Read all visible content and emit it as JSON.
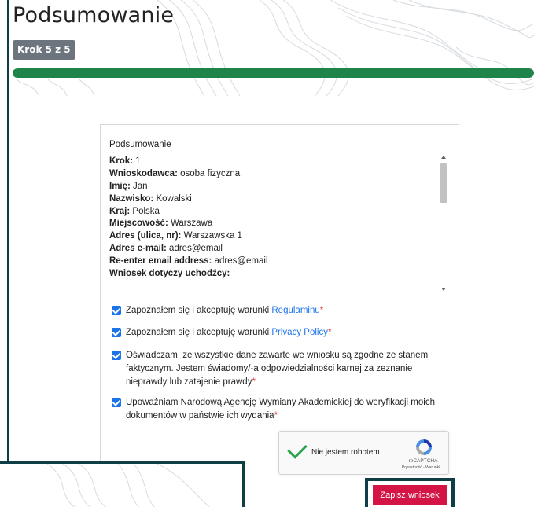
{
  "header": {
    "title": "Podsumowanie",
    "step_badge": "Krok 5 z 5",
    "progress_fraction": 1.0,
    "accent_color": "#1e8449"
  },
  "summary": {
    "heading": "Podsumowanie",
    "rows": [
      {
        "label": "Krok:",
        "value": " 1"
      },
      {
        "label": "Wnioskodawca:",
        "value": " osoba fizyczna"
      },
      {
        "label": "Imię:",
        "value": " Jan"
      },
      {
        "label": "Nazwisko:",
        "value": " Kowalski"
      },
      {
        "label": "Kraj:",
        "value": " Polska"
      },
      {
        "label": "Miejscowość:",
        "value": " Warszawa"
      },
      {
        "label": "Adres (ulica, nr):",
        "value": " Warszawska 1"
      },
      {
        "label": "Adres e-mail:",
        "value": " adres@email"
      },
      {
        "label": "Re-enter email address:",
        "value": " adres@email"
      },
      {
        "label": "Wniosek dotyczy uchodźcy:",
        "value": ""
      }
    ]
  },
  "consents": [
    {
      "text": "Zapoznałem się i akceptuję warunki ",
      "link": "Regulaminu",
      "required": "*"
    },
    {
      "text": "Zapoznałem się i akceptuję warunki ",
      "link": "Privacy Policy",
      "required": "*"
    },
    {
      "text": "Oświadczam, że wszystkie dane zawarte we wniosku są zgodne ze stanem faktycznym. Jestem świadomy/-a odpowiedzialności karnej za zeznanie nieprawdy lub zatajenie prawdy",
      "link": "",
      "required": "*"
    },
    {
      "text": "Upoważniam Narodową Agencję Wymiany Akademickiej do weryfikacji moich dokumentów w państwie ich wydania",
      "link": "",
      "required": "*"
    }
  ],
  "recaptcha": {
    "label": "Nie jestem robotem",
    "brand": "reCAPTCHA",
    "links": "Prywatność - Warunki"
  },
  "submit": {
    "label": "Zapisz wniosek",
    "color": "#d41444"
  }
}
